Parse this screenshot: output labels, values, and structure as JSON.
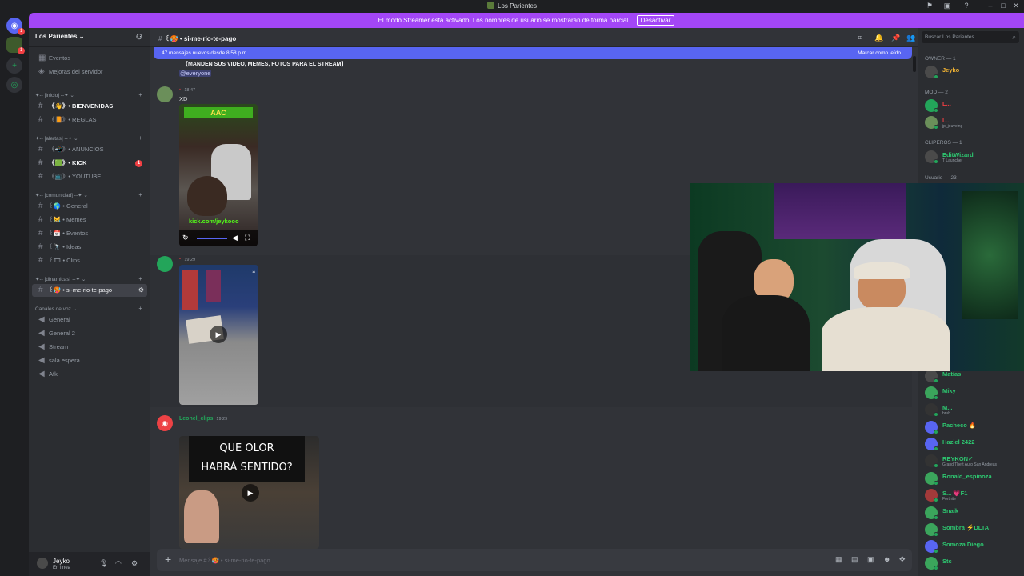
{
  "window": {
    "title": "Los Parientes"
  },
  "banner": {
    "text": "El modo Streamer está activado. Los nombres de usuario se mostrarán de forma parcial.",
    "button": "Desactivar"
  },
  "server": {
    "name": "Los Parientes ⌄"
  },
  "sidebar": {
    "top": [
      {
        "label": "Eventos"
      },
      {
        "label": "Mejoras del servidor"
      }
    ],
    "cat_inicio": "✦-- [inicio] --✦ ⌄",
    "cat_alertas": "✦-- [alertas] --✦ ⌄",
    "cat_comunidad": "✦-- [comunidad] --✦ ⌄",
    "cat_dinamicas": "✦-- [dinamicas] --✦ ⌄",
    "cat_voz": "Canales de voz ⌄",
    "channels": [
      {
        "label": "《👋》• BIENVENIDAS"
      },
      {
        "label": "《📙》• REGLAS"
      },
      {
        "label": "《📲》• ANUNCIOS"
      },
      {
        "label": "《🟩》• KICK"
      },
      {
        "label": "《📺》• YOUTUBE"
      },
      {
        "label": "꒰🌎 • General"
      },
      {
        "label": "꒰😹 • Memes"
      },
      {
        "label": "꒰📅 • Eventos"
      },
      {
        "label": "꒰🔭 • Ideas"
      },
      {
        "label": "꒰🎞 • Clips"
      },
      {
        "label": "꒰🥵 • si-me-rio-te-pago"
      }
    ],
    "kick_badge": "1",
    "voice": [
      {
        "label": "General"
      },
      {
        "label": "General 2"
      },
      {
        "label": "Stream"
      },
      {
        "label": "sala espera"
      },
      {
        "label": "Afk"
      }
    ]
  },
  "user": {
    "name": "Jeyko",
    "status": "En línea"
  },
  "channel": {
    "name": "꒰🥵 • si-me-rio-te-pago"
  },
  "new_messages": {
    "text": "47 mensajes nuevos desde 8:58 p.m.",
    "action": "Marcar como leído"
  },
  "messages": {
    "pinned_line": "【MANDEN SUS VIDEO,  MEMES, FOTOS PARA EL STREAM】",
    "everyone": "@everyone",
    "m1": {
      "time": "18:47",
      "text": "XD",
      "overlay": "kick.com/jeykooo"
    },
    "m2": {
      "time": "19:29"
    },
    "m3": {
      "author": "Leonel_clips",
      "time": "19:29",
      "caption_line1": "QUE OLOR",
      "caption_line2": "HABRÁ SENTIDO?"
    }
  },
  "composer": {
    "placeholder": "Mensaje #꒰🥵 • si-me-rio-te-pago"
  },
  "members_panel": {
    "search": "Buscar Los Parientes",
    "owner_header": "OWNER — 1",
    "mod_header": "MOD — 2",
    "clipper_header": "CLIPEROS — 1",
    "user_header": "Usuario — 23",
    "owner": {
      "name": "Jeyko"
    },
    "mods": [
      {
        "name": "L...",
        "sub": ""
      },
      {
        "name": "l...",
        "sub": "jp_jouvelng"
      }
    ],
    "clipper": {
      "name": "EditWizard",
      "sub": "T Launcher"
    },
    "users": [
      {
        "name": "Matías",
        "sub": ""
      },
      {
        "name": "Miky",
        "sub": ""
      },
      {
        "name": "M...",
        "sub": "bruh"
      },
      {
        "name": "Pacheco 🔥",
        "sub": ""
      },
      {
        "name": "Haziel 2422",
        "sub": ""
      },
      {
        "name": "REYKON✓",
        "sub": "Grand Theft Auto San Andreas"
      },
      {
        "name": "Ronald_espinoza",
        "sub": ""
      },
      {
        "name": "S... 💗F1",
        "sub": "Fortnite"
      },
      {
        "name": "Snaik",
        "sub": ""
      },
      {
        "name": "Sombra ⚡DLTA",
        "sub": ""
      },
      {
        "name": "Somoza Diego",
        "sub": ""
      },
      {
        "name": "Stc",
        "sub": ""
      }
    ]
  },
  "colors": {
    "accent": "#5865f2",
    "streamer": "#a346f6",
    "online": "#23a55a",
    "member_green": "#2dc770",
    "owner_gold": "#f0b232"
  }
}
